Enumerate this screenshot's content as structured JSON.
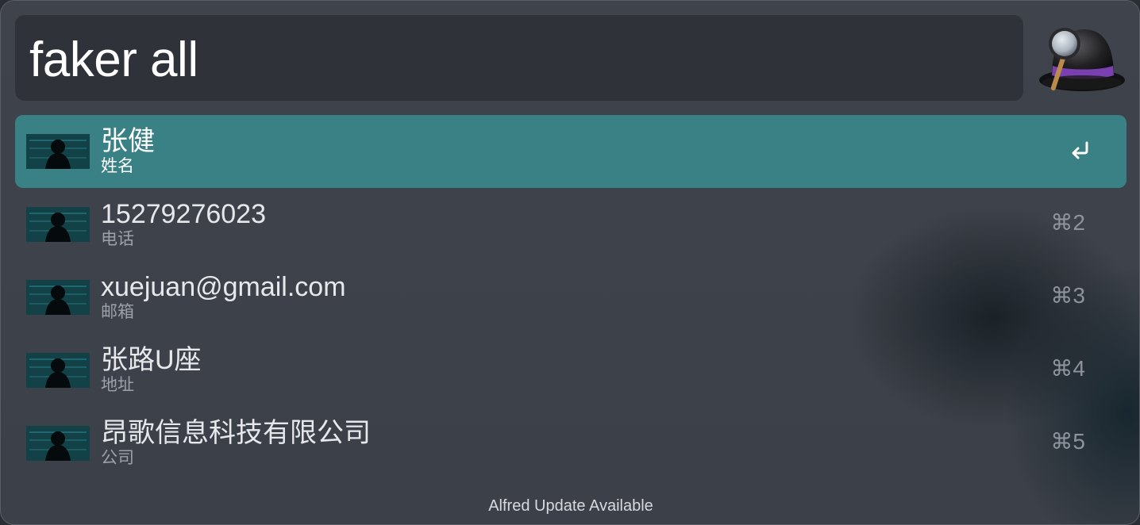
{
  "search": {
    "query": "faker all"
  },
  "results": [
    {
      "title": "张健",
      "subtitle": "姓名",
      "shortcut": "",
      "selected": true
    },
    {
      "title": "15279276023",
      "subtitle": "电话",
      "shortcut": "⌘2",
      "selected": false
    },
    {
      "title": "xuejuan@gmail.com",
      "subtitle": "邮箱",
      "shortcut": "⌘3",
      "selected": false
    },
    {
      "title": "张路U座",
      "subtitle": "地址",
      "shortcut": "⌘4",
      "selected": false
    },
    {
      "title": "昂歌信息科技有限公司",
      "subtitle": "公司",
      "shortcut": "⌘5",
      "selected": false
    }
  ],
  "icons": {
    "logo": "alfred-hat-magnifier-icon",
    "result_icon": "hacker-silhouette-icon",
    "return": "return-key-icon"
  },
  "footer": {
    "status": "Alfred Update Available"
  },
  "colors": {
    "selected_row": "#3a8185",
    "window_bg": "#3f434b",
    "search_bg": "#2f3238",
    "hat_band": "#7a3fb0"
  }
}
